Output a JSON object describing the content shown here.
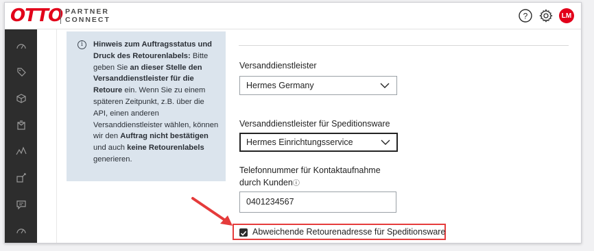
{
  "header": {
    "logo_text": "OTTO",
    "logo_sub_line1": "PARTNER",
    "logo_sub_line2": "CONNECT",
    "icons": [
      "help-icon",
      "settings-icon"
    ],
    "avatar_initials": "LM",
    "brand_color": "#e2001a"
  },
  "sidebar": {
    "background": "#2d2d2d",
    "icons": [
      "dashboard-gauge-icon",
      "tag-icon",
      "package-icon",
      "returns-box-icon",
      "analytics-line-icon",
      "products-edit-icon",
      "messages-icon",
      "dashboard-gauge-icon"
    ]
  },
  "infobox": {
    "icon": "info-icon",
    "parts": [
      "Hinweis zum Auftragsstatus und Druck des Retourenlabels:",
      " Bitte geben Sie ",
      "an dieser Stelle den Versanddienstleister für die Retoure",
      " ein. Wenn Sie zu einem späteren Zeitpunkt, z.B. über die API, einen anderen Versanddienstleister wählen, können wir den ",
      "Auftrag nicht bestätigen",
      " und auch ",
      "keine Retourenlabels",
      " generieren."
    ]
  },
  "form": {
    "carrier": {
      "label": "Versanddienstleister",
      "value": "Hermes Germany"
    },
    "freight_carrier": {
      "label": "Versanddienstleister für Speditionsware",
      "value": "Hermes Einrichtungsservice"
    },
    "phone": {
      "label_line1": "Telefonnummer für Kontaktaufnahme",
      "label_line2": "durch Kunden",
      "info_glyph": "ⓘ",
      "value": "0401234567"
    },
    "checkbox": {
      "label": "Abweichende Retourenadresse für Speditionsware",
      "checked": true
    }
  },
  "annotation": {
    "highlight_color": "#e53b3b"
  }
}
